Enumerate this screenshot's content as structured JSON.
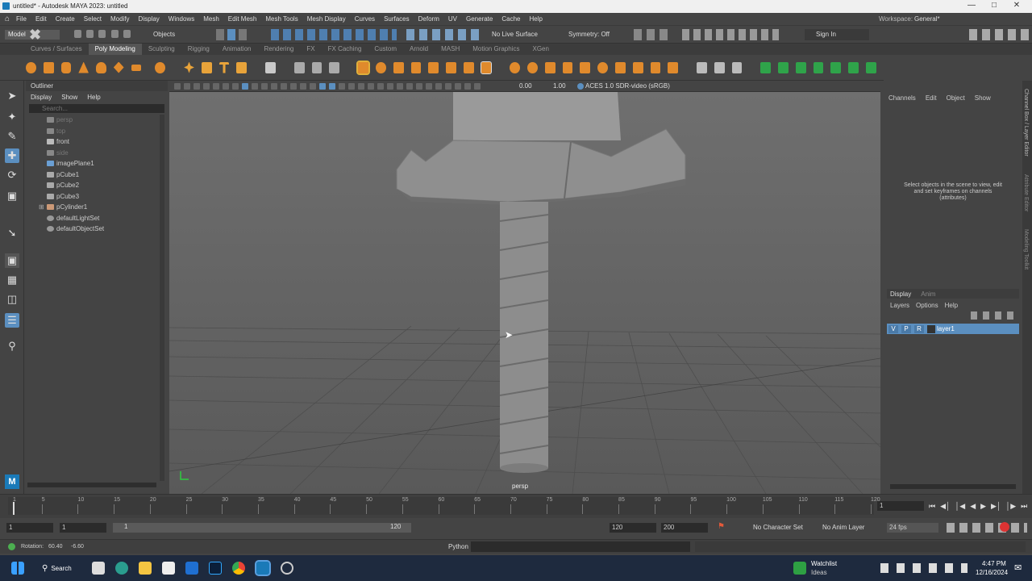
{
  "window": {
    "title": "untitled* - Autodesk MAYA 2023: untitled",
    "controls": [
      "minimize-icon",
      "maximize-icon",
      "close-icon"
    ]
  },
  "menubar": {
    "items": [
      "File",
      "Edit",
      "Create",
      "Select",
      "Modify",
      "Display",
      "Windows",
      "Mesh",
      "Edit Mesh",
      "Mesh Tools",
      "Mesh Display",
      "Curves",
      "Surfaces",
      "Deform",
      "UV",
      "Generate",
      "Cache",
      "Help"
    ],
    "workspace_label": "Workspace:",
    "workspace_value": "General*"
  },
  "statusline": {
    "mode": "Model",
    "select_mode": "Objects",
    "live_surface": "No Live Surface",
    "symmetry": "Symmetry: Off",
    "signin": "Sign In"
  },
  "shelf": {
    "tabs": [
      "Curves / Surfaces",
      "Poly Modeling",
      "Sculpting",
      "Rigging",
      "Animation",
      "Rendering",
      "FX",
      "FX Caching",
      "Custom",
      "Arnold",
      "MASH",
      "Motion Graphics",
      "XGen"
    ],
    "active_tab": "Poly Modeling"
  },
  "outliner": {
    "title": "Outliner",
    "menu": [
      "Display",
      "Show",
      "Help"
    ],
    "search_placeholder": "Search...",
    "items": [
      {
        "label": "persp",
        "dim": true
      },
      {
        "label": "top",
        "dim": true
      },
      {
        "label": "front",
        "dim": false
      },
      {
        "label": "side",
        "dim": true
      },
      {
        "label": "imagePlane1",
        "dim": false
      },
      {
        "label": "pCube1",
        "dim": false
      },
      {
        "label": "pCube2",
        "dim": false
      },
      {
        "label": "pCube3",
        "dim": false
      },
      {
        "label": "pCylinder1",
        "dim": false,
        "expandable": true
      },
      {
        "label": "defaultLightSet",
        "dim": false
      },
      {
        "label": "defaultObjectSet",
        "dim": false
      }
    ]
  },
  "viewport": {
    "camera_label": "persp",
    "field_a": "0.00",
    "field_b": "1.00",
    "colorspace": "ACES 1.0 SDR-video (sRGB)"
  },
  "channelbox": {
    "menu": [
      "Channels",
      "Edit",
      "Object",
      "Show"
    ],
    "empty_message": "Select objects in the scene to view, edit and set keyframes on channels (attributes)",
    "layer_tabs": [
      "Display",
      "Anim"
    ],
    "layer_menu": [
      "Layers",
      "Options",
      "Help"
    ],
    "layer": {
      "v": "V",
      "p": "P",
      "r": "R",
      "name": "layer1"
    }
  },
  "side_tabs": [
    "Channel Box / Layer Editor",
    "Attribute Editor",
    "Modeling Toolkit"
  ],
  "timeline": {
    "ticks": [
      "1",
      "5",
      "10",
      "15",
      "20",
      "25",
      "30",
      "35",
      "40",
      "45",
      "50",
      "55",
      "60",
      "65",
      "70",
      "75",
      "80",
      "85",
      "90",
      "95",
      "100",
      "105",
      "110",
      "115",
      "120"
    ],
    "current_frame": "1"
  },
  "range": {
    "start": "1",
    "start_inner": "1",
    "slider_start": "1",
    "slider_end": "120",
    "end_inner": "120",
    "end": "200",
    "character_set": "No Character Set",
    "anim_layer": "No Anim Layer",
    "fps": "24 fps"
  },
  "cmdline": {
    "help_text": "Rotation:",
    "help_value_1": "60.40",
    "help_value_2": "-6.60",
    "lang": "Python"
  },
  "taskbar": {
    "search": "Search",
    "watchlist_title": "Watchlist",
    "watchlist_sub": "Ideas",
    "time": "4:47 PM",
    "date": "12/16/2024"
  }
}
